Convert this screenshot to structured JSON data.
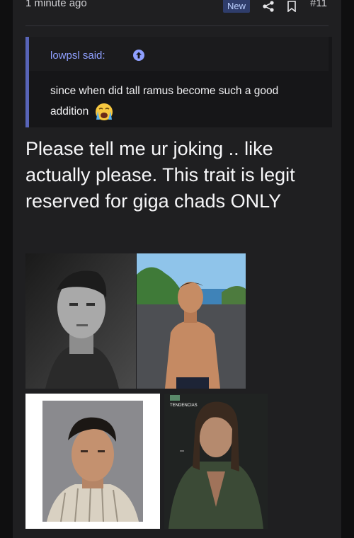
{
  "header": {
    "timestamp": "1 minute ago",
    "new_badge": "New",
    "post_number": "#11"
  },
  "quote": {
    "author": "lowpsl said:",
    "text": "since when did tall ramus become such a good addition",
    "emoji": "😭"
  },
  "reply": {
    "text": "Please tell me ur joking .. like actually please. This trait is legit reserved for giga chads ONLY"
  },
  "images": [
    {
      "name": "bw-portrait-photo"
    },
    {
      "name": "shirtless-man-outdoor-photo"
    },
    {
      "name": "portrait-striped-shirt-photo"
    },
    {
      "name": "magazine-cover-photo",
      "cover_text": "TENDENCIAS"
    }
  ],
  "colors": {
    "accent": "#5864b8",
    "quote_author": "#8fa0ff",
    "background": "#1f1f21"
  }
}
